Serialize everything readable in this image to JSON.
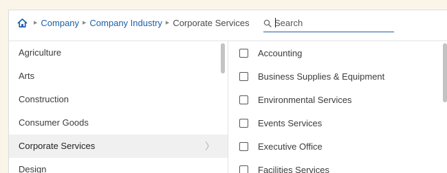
{
  "breadcrumb": {
    "home_icon": "home-icon",
    "items": [
      "Company",
      "Company Industry"
    ],
    "current": "Corporate Services"
  },
  "search": {
    "placeholder": "Search",
    "value": "",
    "icon": "search-icon"
  },
  "industries": [
    {
      "label": "Agriculture",
      "selected": false
    },
    {
      "label": "Arts",
      "selected": false
    },
    {
      "label": "Construction",
      "selected": false
    },
    {
      "label": "Consumer Goods",
      "selected": false
    },
    {
      "label": "Corporate Services",
      "selected": true
    },
    {
      "label": "Design",
      "selected": false
    }
  ],
  "sub_industries": [
    {
      "label": "Accounting",
      "checked": false
    },
    {
      "label": "Business Supplies & Equipment",
      "checked": false
    },
    {
      "label": "Environmental Services",
      "checked": false
    },
    {
      "label": "Events Services",
      "checked": false
    },
    {
      "label": "Executive Office",
      "checked": false
    },
    {
      "label": "Facilities Services",
      "checked": false
    }
  ],
  "colors": {
    "link": "#1a5fa8",
    "background": "#fbf5e9",
    "selected_row": "#f0f0f0"
  }
}
